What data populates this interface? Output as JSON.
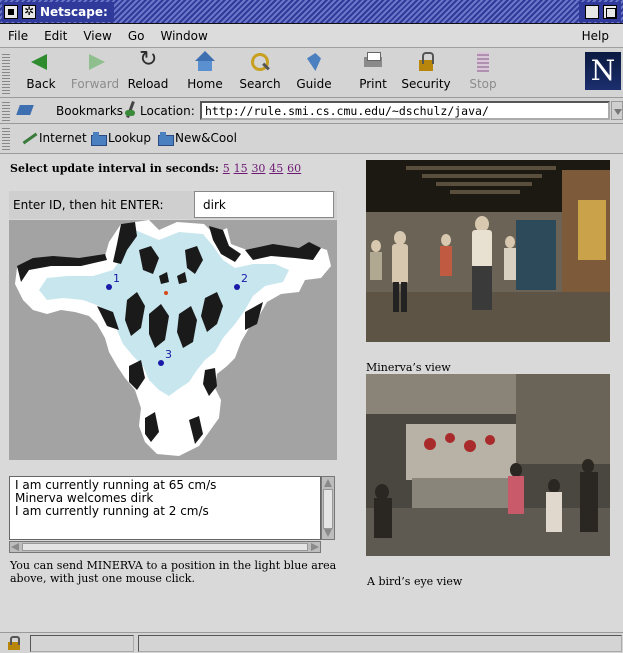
{
  "window": {
    "title": "Netscape:"
  },
  "menu": [
    "File",
    "Edit",
    "View",
    "Go",
    "Window"
  ],
  "menu_help": "Help",
  "toolbar": {
    "buttons": [
      {
        "label": "Back",
        "icon": "back-arrow-icon"
      },
      {
        "label": "Forward",
        "icon": "forward-arrow-icon",
        "disabled": true
      },
      {
        "label": "Reload",
        "icon": "reload-icon"
      },
      {
        "label": "Home",
        "icon": "home-icon"
      },
      {
        "label": "Search",
        "icon": "search-icon"
      },
      {
        "label": "Guide",
        "icon": "guide-icon"
      },
      {
        "label": "Print",
        "icon": "print-icon"
      },
      {
        "label": "Security",
        "icon": "security-lock-icon"
      },
      {
        "label": "Stop",
        "icon": "stop-icon",
        "disabled": true
      }
    ],
    "logo": "N"
  },
  "location": {
    "bookmarks_label": "Bookmarks",
    "location_label": "Location:",
    "url": "http://rule.smi.cs.cmu.edu/~dschulz/java/"
  },
  "personal_toolbar": [
    "Internet",
    "Lookup",
    "New&Cool"
  ],
  "page": {
    "interval_label": "Select update interval in seconds:",
    "interval_options": [
      "5",
      "15",
      "30",
      "45",
      "60"
    ],
    "id_label": "Enter ID, then hit ENTER:",
    "id_value": "dirk",
    "map_markers": [
      "1",
      "2",
      "3"
    ],
    "log_lines": [
      "I am currently running at 65 cm/s",
      "Minerva welcomes  dirk",
      "I am currently running at 2 cm/s"
    ],
    "instruction": "You can send MINERVA to a position in the light blue area above, with just one mouse click.",
    "caption1": "Minerva’s view",
    "caption2": "A bird’s eye view"
  },
  "colors": {
    "title_bar": "#2f3a9a",
    "map_free_space": "#c8e6ee",
    "marker": "#1a1aa8",
    "robot": "#d84a1a",
    "link_visited": "#6e1a74"
  }
}
